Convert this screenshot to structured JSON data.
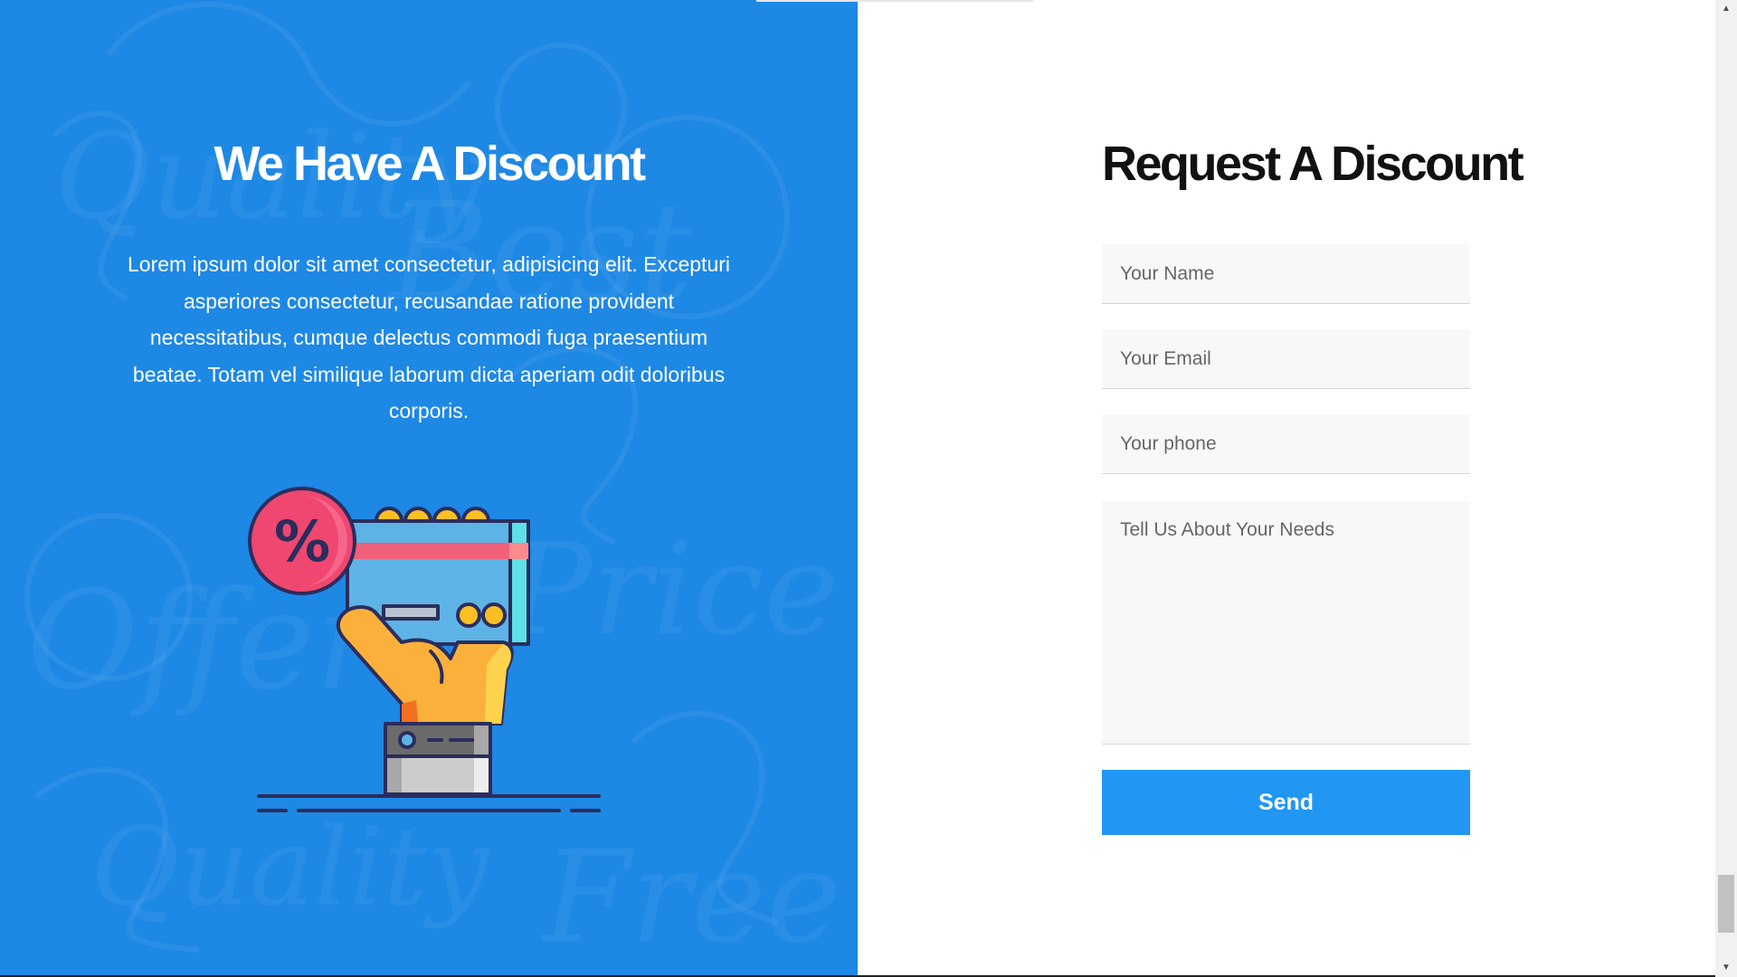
{
  "promo": {
    "title": "We Have A Discount",
    "text": "Lorem ipsum dolor sit amet consectetur, adipisicing elit. Excepturi asperiores consectetur, recusandae ratione provident necessitatibus, cumque delectus commodi fuga praesentium beatae. Totam vel similique laborum dicta aperiam odit doloribus corporis.",
    "illustration_icon": "hand-holding-discount-card-icon",
    "percent_symbol": "%",
    "background_color": "#1e88e5"
  },
  "form": {
    "title": "Request A Discount",
    "name_placeholder": "Your Name",
    "email_placeholder": "Your Email",
    "phone_placeholder": "Your phone",
    "needs_placeholder": "Tell Us About Your Needs",
    "send_label": "Send",
    "button_color": "#2196f3"
  },
  "top_progress": {
    "fraction": 0.16,
    "accent_color": "#1e88e5"
  },
  "scrollbar": {
    "up_icon": "arrow-up-icon",
    "down_icon": "arrow-down-icon",
    "position_fraction": 0.97
  }
}
